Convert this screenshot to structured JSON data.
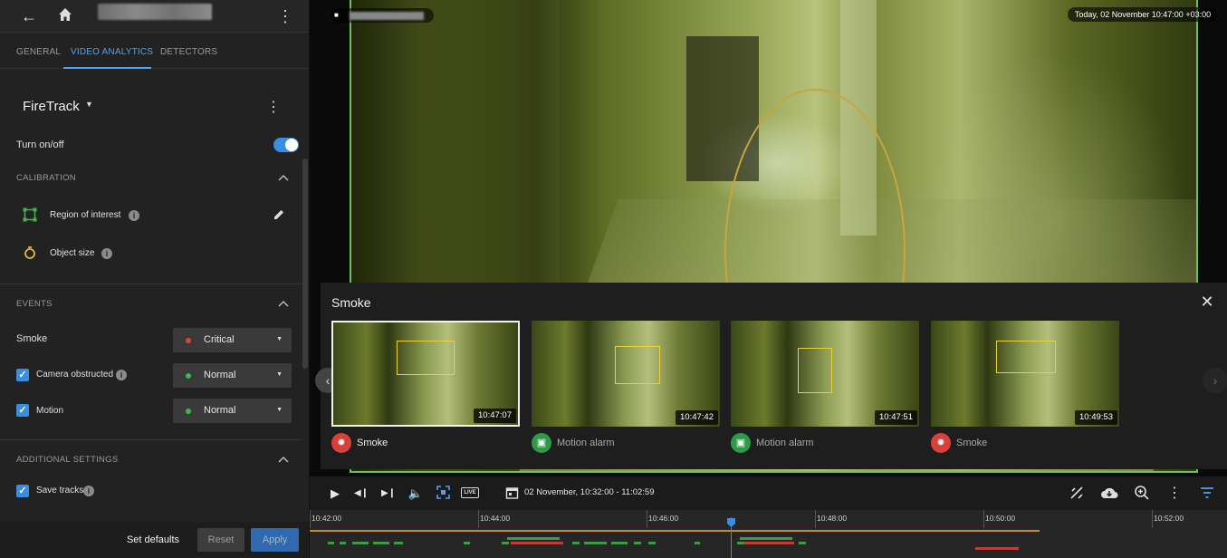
{
  "header": {
    "camera_name": "",
    "back_icon": "arrow-left-icon",
    "home_icon": "home-icon",
    "menu_icon": "more-vert-icon"
  },
  "tabs": [
    {
      "label": "GENERAL",
      "active": false
    },
    {
      "label": "VIDEO ANALYTICS",
      "active": true
    },
    {
      "label": "DETECTORS",
      "active": false
    }
  ],
  "detector": {
    "name": "FireTrack"
  },
  "turn_on": {
    "label": "Turn on/off",
    "enabled": true
  },
  "calibration": {
    "heading": "CALIBRATION",
    "region_of_interest": "Region of interest",
    "object_size": "Object size"
  },
  "events": {
    "heading": "EVENTS",
    "items": [
      {
        "label": "Smoke",
        "severity": "Critical",
        "severity_color": "#e0443e",
        "checked": null
      },
      {
        "label": "Camera obstructed",
        "severity": "Normal",
        "severity_color": "#3fb34f",
        "checked": true
      },
      {
        "label": "Motion",
        "severity": "Normal",
        "severity_color": "#3fb34f",
        "checked": true
      }
    ]
  },
  "additional": {
    "heading": "ADDITIONAL SETTINGS",
    "save_tracks": "Save tracks",
    "save_tracks_checked": true
  },
  "footer": {
    "set_defaults": "Set defaults",
    "reset": "Reset",
    "apply": "Apply"
  },
  "video": {
    "timestamp": "Today, 02 November 10:47:00 +03:00",
    "accent": "#6fbf5a"
  },
  "popup": {
    "title": "Smoke",
    "items": [
      {
        "time": "10:47:07",
        "label": "Smoke",
        "icon": "smoke-icon",
        "color": "#d9403a",
        "selected": true
      },
      {
        "time": "10:47:42",
        "label": "Motion alarm",
        "icon": "motion-icon",
        "color": "#2e9a48",
        "selected": false
      },
      {
        "time": "10:47:51",
        "label": "Motion alarm",
        "icon": "motion-icon",
        "color": "#2e9a48",
        "selected": false
      },
      {
        "time": "10:49:53",
        "label": "Smoke",
        "icon": "smoke-icon",
        "color": "#d9403a",
        "selected": false
      }
    ]
  },
  "controls": {
    "live": "LIVE",
    "range": "02 November, 10:32:00 - 11:02:59"
  },
  "timeline": {
    "ticks": [
      "10:42:00",
      "10:44:00",
      "10:46:00",
      "10:48:00",
      "10:50:00",
      "10:52:00"
    ]
  }
}
